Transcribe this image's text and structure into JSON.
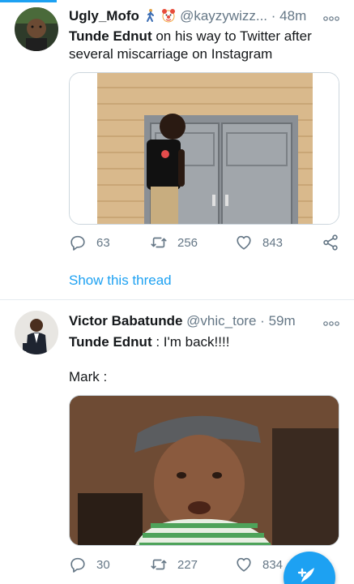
{
  "tweets": [
    {
      "name": "Ugly_Mofo",
      "handle": "@kayzywizz...",
      "separator": "·",
      "time": "48m",
      "text_bold": "Tunde Ednut",
      "text_rest": " on his way to Twitter after several miscarriage on Instagram",
      "reply_count": "63",
      "retweet_count": "256",
      "like_count": "843",
      "show_thread": "Show this thread"
    },
    {
      "name": "Victor Babatunde",
      "handle": "@vhic_tore",
      "separator": "·",
      "time": "59m",
      "text_bold": "Tunde Ednut",
      "text_rest": " : I'm back!!!!",
      "mark_line": "Mark  :",
      "reply_count": "30",
      "retweet_count": "227",
      "like_count": "834"
    }
  ],
  "icons": {
    "emoji1": "person-walking-emoji",
    "emoji2": "clown-face-emoji",
    "more": "more-options-icon",
    "reply": "reply-icon",
    "retweet": "retweet-icon",
    "like": "heart-icon",
    "share": "share-icon",
    "compose": "compose-tweet-icon"
  },
  "colors": {
    "accent": "#1da1f2",
    "secondary_text": "#657786",
    "primary_text": "#14171a"
  }
}
